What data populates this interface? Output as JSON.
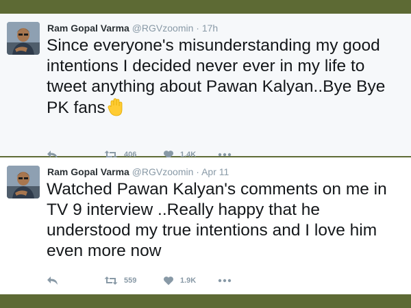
{
  "tweets": [
    {
      "author_name": "Ram Gopal Varma",
      "author_handle": "@RGVzoomin",
      "separator": "·",
      "time": "17h",
      "text": "Since everyone's misunderstanding my good intentions I decided never ever in my life to tweet anything about Pawan Kalyan..Bye Bye PK fans",
      "emoji": "raised-hand-emoji",
      "retweets": "406",
      "likes": "1.4K"
    },
    {
      "author_name": "Ram Gopal Varma",
      "author_handle": "@RGVzoomin",
      "separator": "·",
      "time": "Apr 11",
      "text": "Watched Pawan Kalyan's comments on me in TV 9 interview ..Really happy that he understood my true intentions and I love him even more now",
      "retweets": "559",
      "likes": "1.9K"
    }
  ],
  "colors": {
    "frame": "#5d6a34",
    "card_1": "#f6f8fa",
    "card_2": "#ffffff",
    "text": "#14171a",
    "muted": "#8899a6"
  },
  "icons": [
    "reply-icon",
    "retweet-icon",
    "heart-icon",
    "more-icon"
  ]
}
